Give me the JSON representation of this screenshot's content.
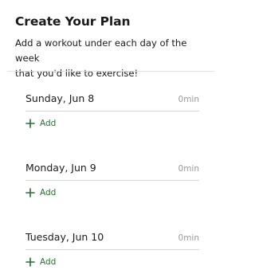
{
  "header": {
    "title": "Create Your Plan",
    "subtitle_line1": "Add a workout under each day of the week",
    "subtitle_line2": "that you'd like to exercise!"
  },
  "days": [
    {
      "name": "Sunday, Jun 8",
      "duration": "0min",
      "add_label": "Add"
    },
    {
      "name": "Monday, Jun 9",
      "duration": "0min",
      "add_label": "Add"
    },
    {
      "name": "Tuesday, Jun 10",
      "duration": "0min",
      "add_label": "Add"
    }
  ],
  "colors": {
    "accent": "#2c6b35",
    "muted": "#9a9a9a",
    "divider": "#d5d5d5"
  }
}
